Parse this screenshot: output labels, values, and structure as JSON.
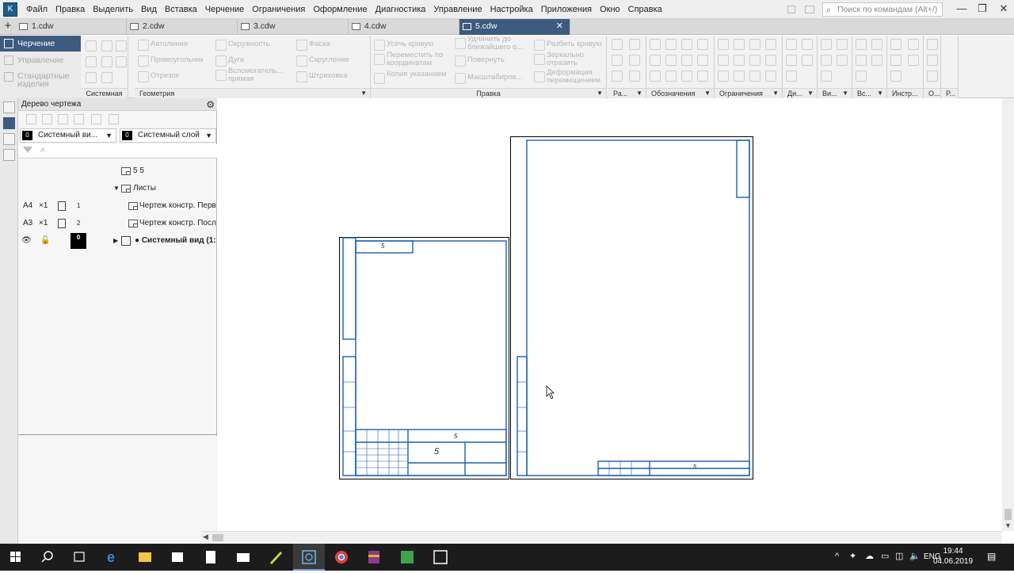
{
  "menubar": {
    "app_icon": "kompas-logo",
    "items": [
      "Файл",
      "Правка",
      "Выделить",
      "Вид",
      "Вставка",
      "Черчение",
      "Ограничения",
      "Оформление",
      "Диагностика",
      "Управление",
      "Настройка",
      "Приложения",
      "Окно",
      "Справка"
    ],
    "search_placeholder": "Поиск по командам (Alt+/)"
  },
  "tabs": [
    {
      "label": "1.cdw"
    },
    {
      "label": "2.cdw"
    },
    {
      "label": "3.cdw"
    },
    {
      "label": "4.cdw"
    },
    {
      "label": "5.cdw",
      "active": true
    }
  ],
  "ribbon": {
    "left_panels": [
      "Черчение",
      "Управление",
      "Стандартные изделия"
    ],
    "groups": [
      {
        "title": "Системная"
      },
      {
        "title": "Геометрия",
        "buttons": [
          "Автолиния",
          "Прямоугольник",
          "Отрезок",
          "Окружность",
          "Дуга",
          "Вспомогатель... прямая",
          "Фаска",
          "Скругление",
          "Штриховка"
        ]
      },
      {
        "title": "Правка",
        "buttons": [
          "Усечь кривую",
          "Удлинить до ближайшего о...",
          "Разбить кривую",
          "Переместить по координатам",
          "Повернуть",
          "Зеркально отразить",
          "Копия указанием",
          "Масштабиров...",
          "Деформация перемещением"
        ]
      },
      {
        "title": "Ра..."
      },
      {
        "title": "Обозначения"
      },
      {
        "title": "Ограничения"
      },
      {
        "title": "Ди..."
      },
      {
        "title": "Ви..."
      },
      {
        "title": "Вс..."
      },
      {
        "title": "Инстр..."
      },
      {
        "title": "О..."
      },
      {
        "title": "Р..."
      }
    ]
  },
  "tree": {
    "title": "Дерево чертежа",
    "view_dropdown": {
      "num": "0",
      "label": "Системный ви..."
    },
    "layer_dropdown": {
      "num": "0",
      "label": "Системный слой"
    },
    "root": "5 5",
    "sheets_label": "Листы",
    "sheets": [
      {
        "format": "A4",
        "mult": "×1",
        "num": "1",
        "label": "Чертеж констр. Перв"
      },
      {
        "format": "A3",
        "mult": "×1",
        "num": "2",
        "label": "Чертеж констр. Посл"
      }
    ],
    "view_row": {
      "num": "0",
      "label": "● Системный вид (1:"
    }
  },
  "drawing": {
    "sheet1_title": "5",
    "sheet1_stamp": "5",
    "sheet2_stamp": "5"
  },
  "taskbar": {
    "lang": "ENG",
    "time": "19:44",
    "date": "04.06.2019"
  }
}
